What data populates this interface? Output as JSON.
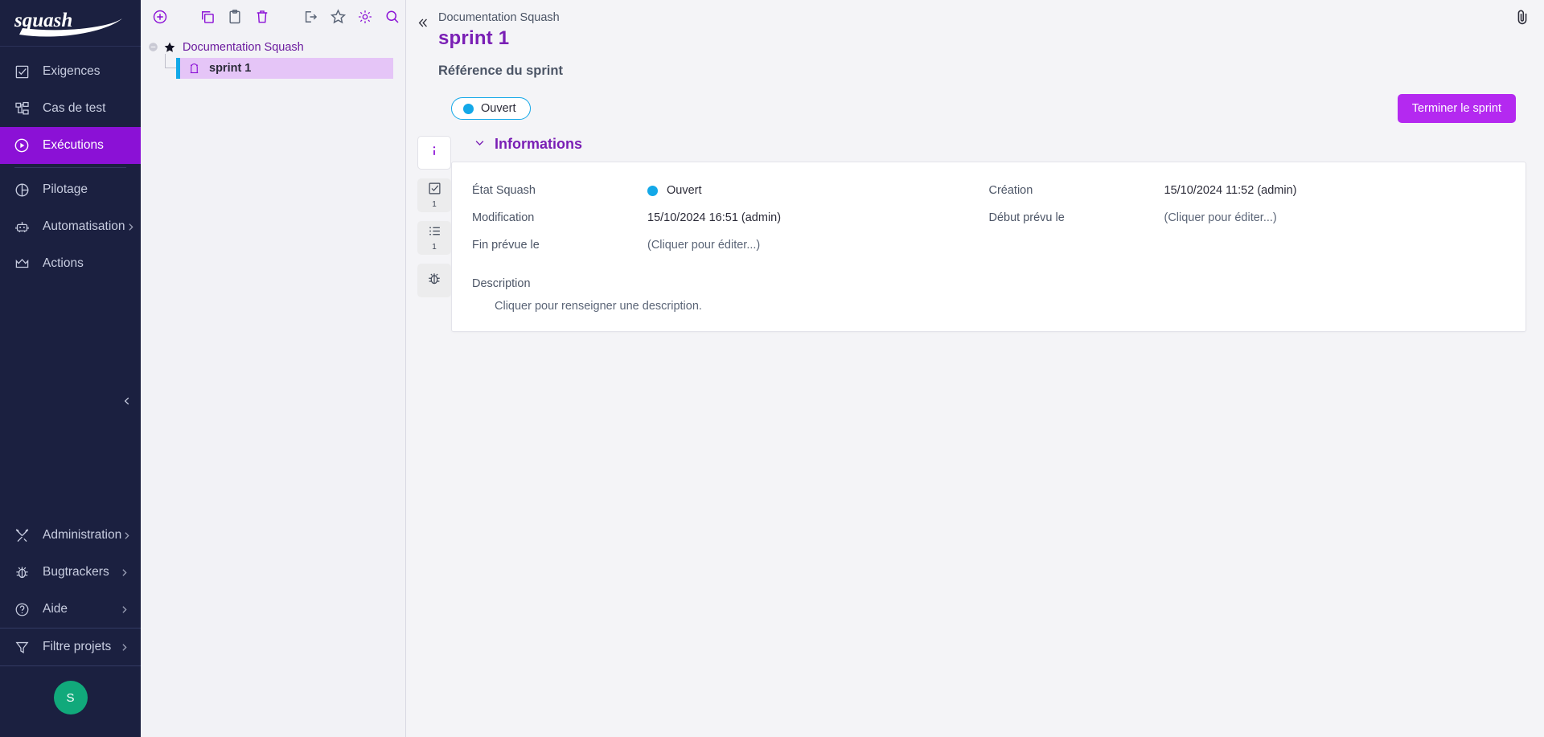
{
  "brand": {
    "logo_text": "squash",
    "accent": "#8b11d6",
    "nav_bg": "#1b2040"
  },
  "sidebar": {
    "items": [
      {
        "label": "Exigences",
        "icon": "checkbox-icon",
        "active": false,
        "chevron": false
      },
      {
        "label": "Cas de test",
        "icon": "test-case-tree-icon",
        "active": false,
        "chevron": false
      },
      {
        "label": "Exécutions",
        "icon": "play-circle-icon",
        "active": true,
        "chevron": false
      },
      {
        "label": "Pilotage",
        "icon": "pie-chart-icon",
        "active": false,
        "chevron": false
      },
      {
        "label": "Automatisation",
        "icon": "robot-icon",
        "active": false,
        "chevron": true
      },
      {
        "label": "Actions",
        "icon": "crown-icon",
        "active": false,
        "chevron": false
      }
    ],
    "bottom_items": [
      {
        "label": "Administration",
        "icon": "tools-icon",
        "chevron": true
      },
      {
        "label": "Bugtrackers",
        "icon": "bug-icon",
        "chevron": true
      },
      {
        "label": "Aide",
        "icon": "help-circle-icon",
        "chevron": true
      },
      {
        "label": "Filtre projets",
        "icon": "funnel-icon",
        "chevron": true
      }
    ],
    "avatar_initial": "S",
    "collapse_icon": "chevron-left-icon"
  },
  "tree": {
    "toolbar": [
      {
        "name": "add-icon",
        "state": "enabled"
      },
      {
        "name": "copy-icon",
        "state": "enabled"
      },
      {
        "name": "paste-icon",
        "state": "disabled"
      },
      {
        "name": "delete-icon",
        "state": "enabled"
      },
      {
        "name": "export-icon",
        "state": "disabled"
      },
      {
        "name": "star-icon",
        "state": "disabled"
      },
      {
        "name": "gear-icon",
        "state": "enabled"
      },
      {
        "name": "search-icon",
        "state": "enabled"
      }
    ],
    "root": {
      "label": "Documentation Squash",
      "expanded": true
    },
    "children": [
      {
        "label": "sprint 1",
        "selected": true,
        "icon": "sprint-icon"
      }
    ]
  },
  "header": {
    "collapse_icon": "chevrons-left-icon",
    "breadcrumb": "Documentation Squash",
    "title": "sprint 1",
    "subtitle": "Référence du sprint",
    "status": {
      "label": "Ouvert",
      "color": "#13a8e8"
    },
    "primary_button": "Terminer le sprint",
    "attachment_icon": "paperclip-icon"
  },
  "vtabs": [
    {
      "name": "information-tab",
      "icon": "info-icon",
      "count": "",
      "active": true
    },
    {
      "name": "test-plan-tab",
      "icon": "checkbox-icon",
      "count": "1",
      "active": false
    },
    {
      "name": "list-tab",
      "icon": "list-icon",
      "count": "1",
      "active": false
    },
    {
      "name": "issues-tab",
      "icon": "bug-icon",
      "count": "",
      "active": false
    }
  ],
  "panel": {
    "title": "Informations",
    "collapse_icon": "chevron-down-icon",
    "left_fields": [
      {
        "label": "État Squash",
        "value": "Ouvert",
        "has_dot": true,
        "editable": false
      },
      {
        "label": "Modification",
        "value": "15/10/2024 16:51 (admin)",
        "has_dot": false,
        "editable": false
      },
      {
        "label": "Fin prévue le",
        "value": "(Cliquer pour éditer...)",
        "has_dot": false,
        "editable": true
      }
    ],
    "right_fields": [
      {
        "label": "Création",
        "value": "15/10/2024 11:52 (admin)",
        "has_dot": false,
        "editable": false
      },
      {
        "label": "Début prévu le",
        "value": "(Cliquer pour éditer...)",
        "has_dot": false,
        "editable": true
      },
      {
        "label": "",
        "value": "",
        "has_dot": false,
        "editable": false
      }
    ],
    "description_label": "Description",
    "description_value": "Cliquer pour renseigner une description."
  }
}
